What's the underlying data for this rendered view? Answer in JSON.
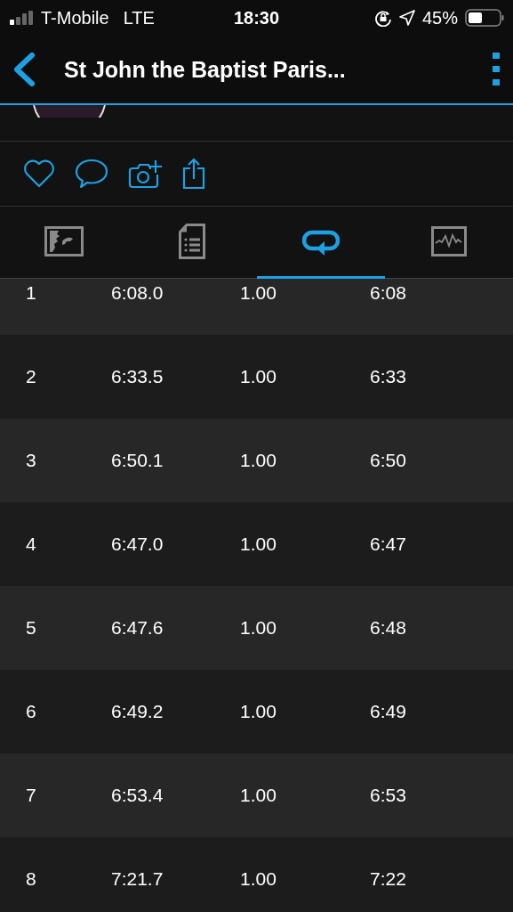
{
  "status_bar": {
    "carrier": "T-Mobile",
    "network": "LTE",
    "time": "18:30",
    "battery": "45%"
  },
  "header": {
    "title": "St John the Baptist Paris..."
  },
  "actions": [
    {
      "kind": "like"
    },
    {
      "kind": "comment"
    },
    {
      "kind": "photo"
    },
    {
      "kind": "share"
    }
  ],
  "tabs": [
    {
      "kind": "map",
      "selected": false
    },
    {
      "kind": "details",
      "selected": false
    },
    {
      "kind": "laps",
      "selected": true
    },
    {
      "kind": "chart",
      "selected": false
    }
  ],
  "laps": [
    {
      "lap": "1",
      "time": "6:08.0",
      "distance": "1.00",
      "pace": "6:08"
    },
    {
      "lap": "2",
      "time": "6:33.5",
      "distance": "1.00",
      "pace": "6:33"
    },
    {
      "lap": "3",
      "time": "6:50.1",
      "distance": "1.00",
      "pace": "6:50"
    },
    {
      "lap": "4",
      "time": "6:47.0",
      "distance": "1.00",
      "pace": "6:47"
    },
    {
      "lap": "5",
      "time": "6:47.6",
      "distance": "1.00",
      "pace": "6:48"
    },
    {
      "lap": "6",
      "time": "6:49.2",
      "distance": "1.00",
      "pace": "6:49"
    },
    {
      "lap": "7",
      "time": "6:53.4",
      "distance": "1.00",
      "pace": "6:53"
    },
    {
      "lap": "8",
      "time": "7:21.7",
      "distance": "1.00",
      "pace": "7:22"
    }
  ]
}
